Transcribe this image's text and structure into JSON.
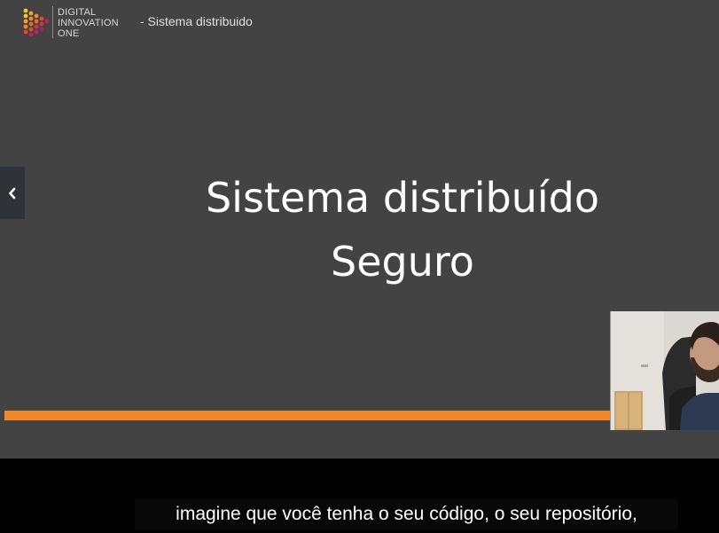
{
  "header": {
    "brand_lines": [
      "DIGITAL",
      "INNOVATION",
      "ONE"
    ],
    "subtitle": "- Sistema distribuido",
    "logo_icon": "dio-logo-icon",
    "logo_colors": [
      "#f7c234",
      "#f1892b",
      "#e8472d",
      "#c2215b"
    ]
  },
  "slide": {
    "title_line_1": "Sistema distribuído",
    "title_line_2": "Seguro",
    "background": "#434343",
    "progress_color": "#f1892b"
  },
  "navigation": {
    "prev_icon": "chevron-left-icon"
  },
  "webcam": {
    "icon": "presenter-video"
  },
  "captions": {
    "text": "imagine que você tenha o seu código, o seu repositório,"
  }
}
